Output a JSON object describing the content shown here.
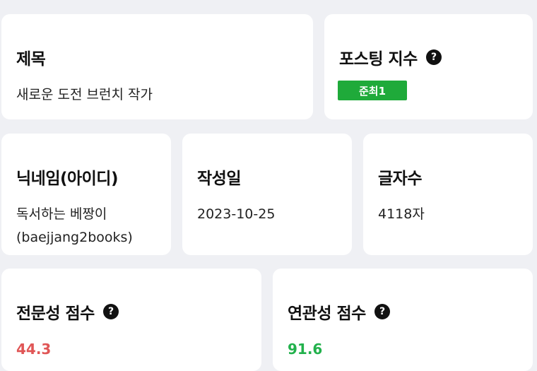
{
  "title_card": {
    "label": "제목",
    "value": "새로운 도전 브런치 작가"
  },
  "posting_index_card": {
    "label": "포스팅 지수",
    "help_icon": "question-circle-icon",
    "badge": "준최1",
    "badge_color": "#1faa3a"
  },
  "nickname_card": {
    "label": "닉네임(아이디)",
    "value_line1": "독서하는 베짱이",
    "value_line2": "(baejjang2books)"
  },
  "date_card": {
    "label": "작성일",
    "value": "2023-10-25"
  },
  "charcount_card": {
    "label": "글자수",
    "value": "4118자"
  },
  "expertise_card": {
    "label": "전문성 점수",
    "help_icon": "question-circle-icon",
    "value": "44.3",
    "value_color": "#e05656"
  },
  "relevance_card": {
    "label": "연관성 점수",
    "help_icon": "question-circle-icon",
    "value": "91.6",
    "value_color": "#22b14c"
  }
}
